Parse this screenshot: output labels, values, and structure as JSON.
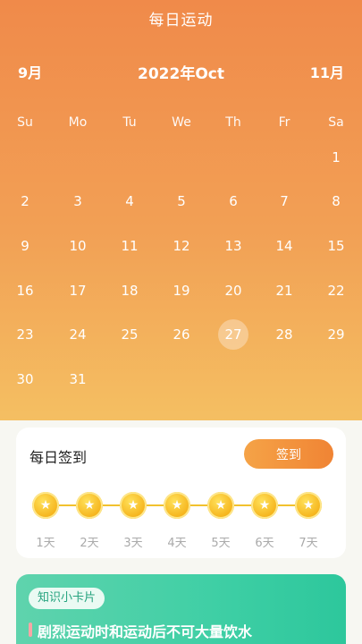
{
  "header": {
    "title": "每日运动"
  },
  "calendar": {
    "prev_month": "9月",
    "current": "2022年Oct",
    "next_month": "11月",
    "weekdays": [
      "Su",
      "Mo",
      "Tu",
      "We",
      "Th",
      "Fr",
      "Sa"
    ],
    "first_weekday_index": 6,
    "days_in_month": 31,
    "today": 27
  },
  "checkin": {
    "title": "每日签到",
    "button_label": "签到",
    "coin_symbol": "★",
    "days": [
      "1天",
      "2天",
      "3天",
      "4天",
      "5天",
      "6天",
      "7天"
    ]
  },
  "knowledge": {
    "tag": "知识小卡片",
    "text": "剧烈运动时和运动后不可大量饮水"
  },
  "colors": {
    "header_top": "#f08a4a",
    "header_bottom": "#f4bf62",
    "button": "#f08434",
    "coin": "#f5b21a",
    "card_green": "#3fcfa5"
  }
}
